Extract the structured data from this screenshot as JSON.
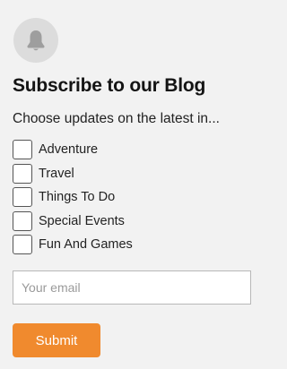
{
  "widget": {
    "icon": "bell-icon",
    "title": "Subscribe to our Blog",
    "subtitle": "Choose updates on the latest in...",
    "options": [
      {
        "label": "Adventure",
        "checked": false
      },
      {
        "label": "Travel",
        "checked": false
      },
      {
        "label": "Things To Do",
        "checked": false
      },
      {
        "label": "Special Events",
        "checked": false
      },
      {
        "label": "Fun And Games",
        "checked": false
      }
    ],
    "email": {
      "value": "",
      "placeholder": "Your email"
    },
    "submit_label": "Submit"
  },
  "colors": {
    "background": "#f2f2f2",
    "accent": "#f08a2e",
    "icon_circle": "#dcdcdc",
    "icon": "#9e9e9e"
  }
}
